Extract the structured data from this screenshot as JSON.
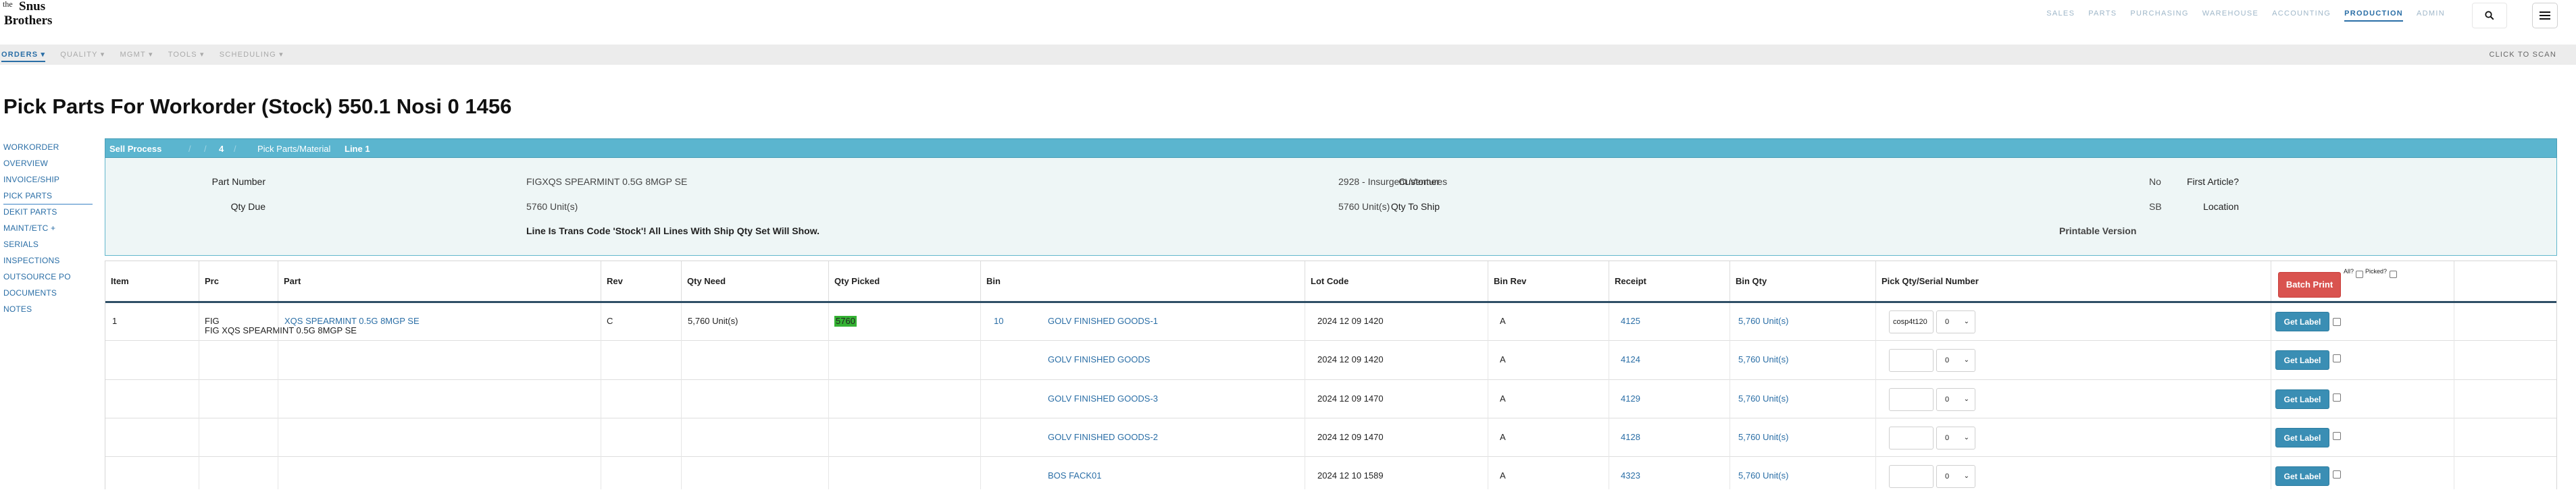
{
  "logo": {
    "line1": "the",
    "line2": "Snus",
    "line3": "Brothers"
  },
  "topnav": [
    {
      "label": "SALES",
      "active": false
    },
    {
      "label": "PARTS",
      "active": false
    },
    {
      "label": "PURCHASING",
      "active": false
    },
    {
      "label": "WAREHOUSE",
      "active": false
    },
    {
      "label": "ACCOUNTING",
      "active": false
    },
    {
      "label": "PRODUCTION",
      "active": true
    },
    {
      "label": "ADMIN",
      "active": false
    }
  ],
  "subnav": {
    "items": [
      "ORDERS ▾",
      "QUALITY ▾",
      "MGMT ▾",
      "TOOLS ▾",
      "SCHEDULING ▾"
    ],
    "click_to_scan": "CLICK TO SCAN"
  },
  "page_title": "Pick Parts For Workorder (Stock) 550.1 Nosi 0 1456",
  "leftnav": [
    "WORKORDER",
    "OVERVIEW",
    "INVOICE/SHIP",
    "PICK PARTS",
    "DEKIT PARTS",
    "MAINT/ETC +",
    "SERIALS",
    "INSPECTIONS",
    "OUTSOURCE PO",
    "DOCUMENTS",
    "NOTES"
  ],
  "process_bar": {
    "sell_process": "Sell Process",
    "steps": [
      "/",
      "/",
      "4",
      "/"
    ],
    "current": "Pick Parts/Material",
    "line": "Line 1"
  },
  "info": {
    "part_number_label": "Part Number",
    "part_number": "FIGXQS SPEARMINT 0.5G 8MGP SE",
    "customer_label": "Customer",
    "customer": "2928 - Insurgent Ventures",
    "first_article_label": "First Article?",
    "first_article": "No",
    "qty_due_label": "Qty Due",
    "qty_due": "5760 Unit(s)",
    "qty_to_ship_label": "Qty To Ship",
    "qty_to_ship": "5760 Unit(s)",
    "location_label": "Location",
    "location": "SB",
    "notice": "Line Is Trans Code 'Stock'! All Lines With Ship Qty Set Will Show.",
    "printable_version": "Printable Version"
  },
  "table": {
    "headers": {
      "item": "Item",
      "prc": "Prc",
      "part": "Part",
      "rev": "Rev",
      "qty_need": "Qty Need",
      "qty_picked": "Qty Picked",
      "bin": "Bin",
      "lot_code": "Lot Code",
      "bin_rev": "Bin Rev",
      "receipt": "Receipt",
      "bin_qty": "Bin Qty",
      "pick_qty": "Pick Qty/Serial Number",
      "batch_print": "Batch Print",
      "all": "All?",
      "picked": "Picked?"
    },
    "first": {
      "item": "1",
      "prc": "FIG",
      "part_link": "XQS SPEARMINT 0.5G 8MGP SE",
      "part_sub": "FIG XQS SPEARMINT 0.5G 8MGP SE",
      "rev": "C",
      "qty_need": "5,760 Unit(s)",
      "qty_picked": "5760",
      "bin_count": "10"
    },
    "rows": [
      {
        "bin": "GOLV FINISHED GOODS-1",
        "lot": "2024 12 09 1420",
        "bin_rev": "A",
        "receipt": "4125",
        "bin_qty": "5,760 Unit(s)",
        "pick": "cosp4t120",
        "sel": "0"
      },
      {
        "bin": "GOLV FINISHED GOODS",
        "lot": "2024 12 09 1420",
        "bin_rev": "A",
        "receipt": "4124",
        "bin_qty": "5,760 Unit(s)",
        "pick": "",
        "sel": "0"
      },
      {
        "bin": "GOLV FINISHED GOODS-3",
        "lot": "2024 12 09 1470",
        "bin_rev": "A",
        "receipt": "4129",
        "bin_qty": "5,760 Unit(s)",
        "pick": "",
        "sel": "0"
      },
      {
        "bin": "GOLV FINISHED GOODS-2",
        "lot": "2024 12 09 1470",
        "bin_rev": "A",
        "receipt": "4128",
        "bin_qty": "5,760 Unit(s)",
        "pick": "",
        "sel": "0"
      },
      {
        "bin": "BOS FACK01",
        "lot": "2024 12 10 1589",
        "bin_rev": "A",
        "receipt": "4323",
        "bin_qty": "5,760 Unit(s)",
        "pick": "",
        "sel": "0"
      }
    ],
    "get_label": "Get Label"
  }
}
